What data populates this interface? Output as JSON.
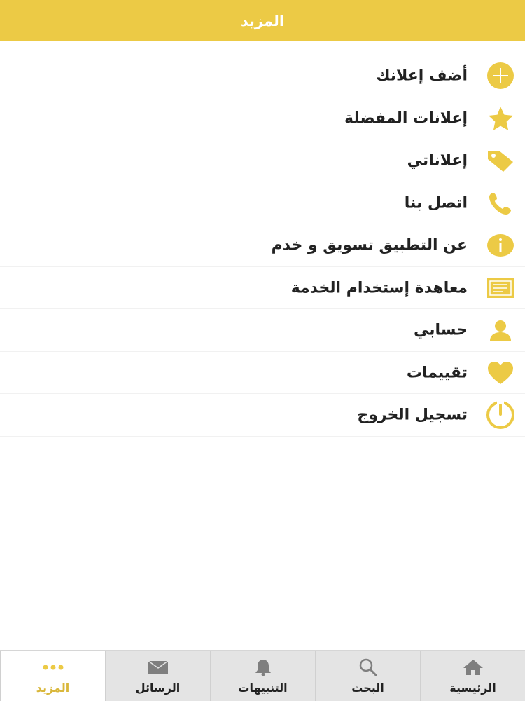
{
  "header": {
    "title": "المزيد"
  },
  "colors": {
    "accent": "#ecca45",
    "tab_active": "#d9b73a"
  },
  "menu": {
    "items": [
      {
        "label": "أضف إعلانك",
        "icon": "plus-circle-icon"
      },
      {
        "label": "إعلانات المفضلة",
        "icon": "star-icon"
      },
      {
        "label": "إعلاناتي",
        "icon": "tag-icon"
      },
      {
        "label": "اتصل بنا",
        "icon": "phone-icon"
      },
      {
        "label": "عن التطبيق تسويق و خدم",
        "icon": "info-icon"
      },
      {
        "label": "معاهدة إستخدام الخدمة",
        "icon": "document-icon"
      },
      {
        "label": "حسابي",
        "icon": "user-icon"
      },
      {
        "label": "تقييمات",
        "icon": "heart-icon"
      },
      {
        "label": "تسجيل الخروج",
        "icon": "power-icon"
      }
    ]
  },
  "tabbar": {
    "items": [
      {
        "label": "الرئيسية",
        "icon": "home-icon"
      },
      {
        "label": "البحث",
        "icon": "search-icon"
      },
      {
        "label": "التنبيهات",
        "icon": "bell-icon"
      },
      {
        "label": "الرسائل",
        "icon": "envelope-icon"
      },
      {
        "label": "المزيد",
        "icon": "more-dots-icon",
        "active": true
      }
    ]
  }
}
